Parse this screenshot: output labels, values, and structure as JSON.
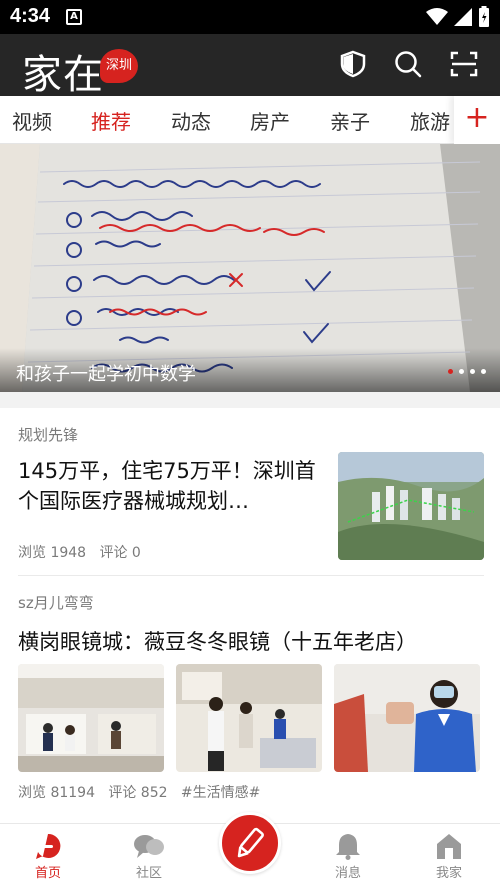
{
  "status_bar": {
    "time": "4:34",
    "notif_icon": "A"
  },
  "app": {
    "logo": "家在",
    "city": "深圳",
    "brand_color": "#d6231f"
  },
  "tabs": [
    {
      "label": "视频",
      "active": false
    },
    {
      "label": "推荐",
      "active": true
    },
    {
      "label": "动态",
      "active": false
    },
    {
      "label": "房产",
      "active": false
    },
    {
      "label": "亲子",
      "active": false
    },
    {
      "label": "旅游",
      "active": false
    }
  ],
  "tabs_add_label": "+",
  "banner": {
    "caption": "和孩子一起学初中数学",
    "page_indicator": {
      "total": 4,
      "current": 1
    }
  },
  "feed": [
    {
      "source": "规划先锋",
      "title": "145万平，住宅75万平！深圳首个国际医疗器械城规划…",
      "views_label": "浏览 1948",
      "comments_label": "评论 0"
    },
    {
      "source": "sz月儿弯弯",
      "title": "横岗眼镜城：薇豆冬冬眼镜（十五年老店）",
      "views_label": "浏览 81194",
      "comments_label": "评论 852",
      "tag": "#生活情感#"
    }
  ],
  "bottom_nav": [
    {
      "label": "首页",
      "icon": "home-icon",
      "active": true
    },
    {
      "label": "社区",
      "icon": "chat-bubbles-icon",
      "active": false
    },
    {
      "label": "消息",
      "icon": "bell-icon",
      "active": false
    },
    {
      "label": "我家",
      "icon": "house-icon",
      "active": false
    }
  ]
}
